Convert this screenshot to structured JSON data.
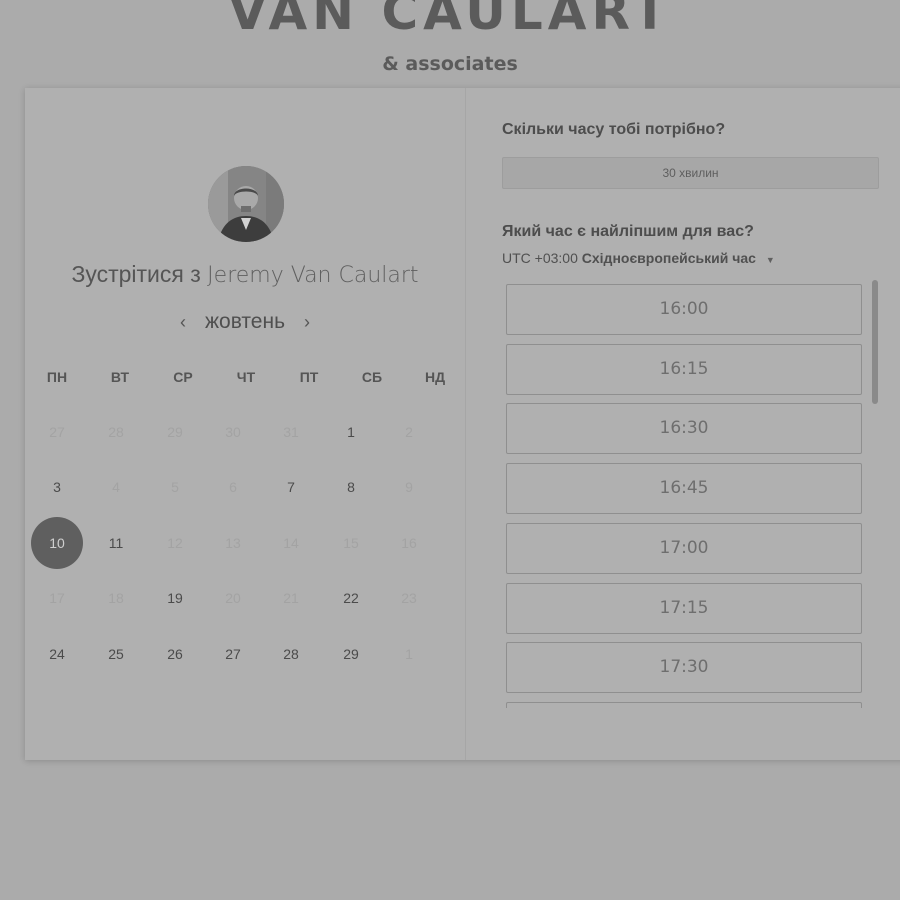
{
  "brand": {
    "name": "VAN CAULART",
    "subtitle": "& associates"
  },
  "left": {
    "meet_prefix": "Зустрітися з",
    "meet_name": "Jeremy Van Caulart",
    "month": "жовтень",
    "weekdays": [
      "ПН",
      "ВТ",
      "СР",
      "ЧТ",
      "ПТ",
      "СБ",
      "НД"
    ],
    "weeks": [
      [
        {
          "d": "27",
          "s": "inactive"
        },
        {
          "d": "28",
          "s": "inactive"
        },
        {
          "d": "29",
          "s": "inactive"
        },
        {
          "d": "30",
          "s": "inactive"
        },
        {
          "d": "31",
          "s": "inactive"
        },
        {
          "d": "1",
          "s": "active"
        },
        {
          "d": "2",
          "s": "inactive"
        }
      ],
      [
        {
          "d": "3",
          "s": "active"
        },
        {
          "d": "4",
          "s": "inactive"
        },
        {
          "d": "5",
          "s": "inactive"
        },
        {
          "d": "6",
          "s": "inactive"
        },
        {
          "d": "7",
          "s": "active"
        },
        {
          "d": "8",
          "s": "active"
        },
        {
          "d": "9",
          "s": "inactive"
        }
      ],
      [
        {
          "d": "10",
          "s": "selected"
        },
        {
          "d": "11",
          "s": "active"
        },
        {
          "d": "12",
          "s": "inactive"
        },
        {
          "d": "13",
          "s": "inactive"
        },
        {
          "d": "14",
          "s": "inactive"
        },
        {
          "d": "15",
          "s": "inactive"
        },
        {
          "d": "16",
          "s": "inactive"
        }
      ],
      [
        {
          "d": "17",
          "s": "inactive"
        },
        {
          "d": "18",
          "s": "inactive"
        },
        {
          "d": "19",
          "s": "active"
        },
        {
          "d": "20",
          "s": "inactive"
        },
        {
          "d": "21",
          "s": "inactive"
        },
        {
          "d": "22",
          "s": "active"
        },
        {
          "d": "23",
          "s": "inactive"
        }
      ],
      [
        {
          "d": "24",
          "s": "active"
        },
        {
          "d": "25",
          "s": "active"
        },
        {
          "d": "26",
          "s": "active"
        },
        {
          "d": "27",
          "s": "active"
        },
        {
          "d": "28",
          "s": "active"
        },
        {
          "d": "29",
          "s": "active"
        },
        {
          "d": "1",
          "s": "inactive"
        }
      ]
    ]
  },
  "right": {
    "duration_question": "Скільки часу тобі потрібно?",
    "duration_value": "30 хвилин",
    "time_question": "Який час є найліпшим для вас?",
    "tz_offset": "UTC +03:00",
    "tz_name": "Східноєвропейський час",
    "slots": [
      "16:00",
      "16:15",
      "16:30",
      "16:45",
      "17:00",
      "17:15",
      "17:30",
      ""
    ]
  },
  "colors": {
    "page_bg": "#ababab",
    "card_bg": "#b0b0b0",
    "selected_day_bg": "#5f5f5f"
  },
  "icons": [
    "chevron-left-icon",
    "chevron-right-icon",
    "caret-down-icon"
  ]
}
